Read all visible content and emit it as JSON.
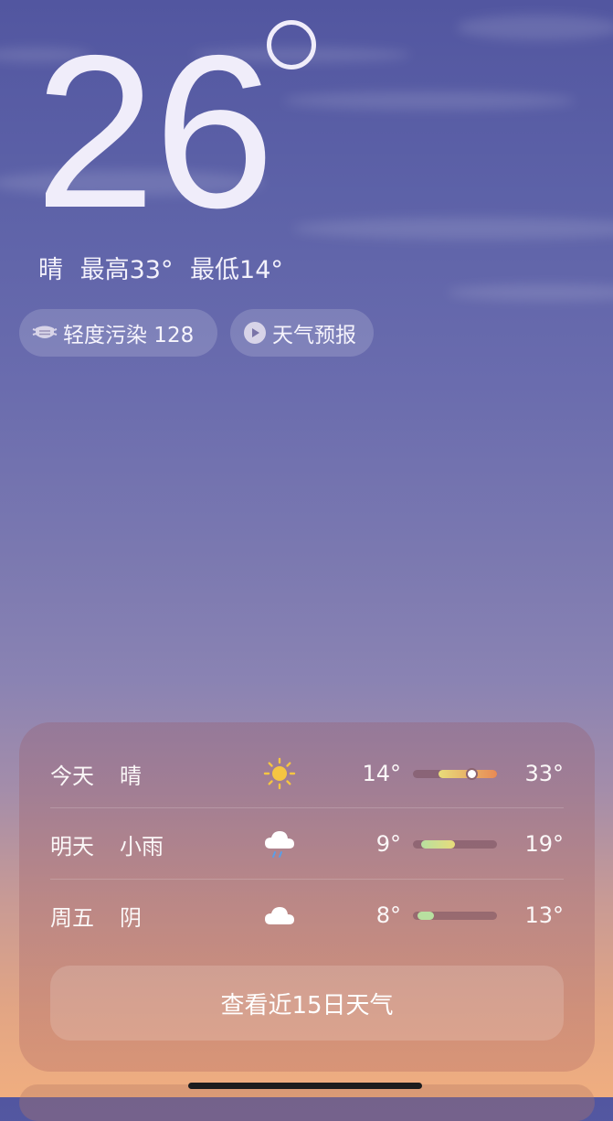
{
  "current": {
    "temperature": "26",
    "condition": "晴",
    "high_text": "最高33°",
    "low_text": "最低14°"
  },
  "chips": {
    "aqi_label": "轻度污染 128",
    "forecast_label": "天气预报"
  },
  "forecast": {
    "rows": [
      {
        "day": "今天",
        "condition": "晴",
        "icon": "sun-icon",
        "low": "14°",
        "high": "33°",
        "range_start": 0.3,
        "range_end": 1.0,
        "current_pos": 0.7
      },
      {
        "day": "明天",
        "condition": "小雨",
        "icon": "rain-cloud-icon",
        "low": "9°",
        "high": "19°",
        "range_start": 0.1,
        "range_end": 0.5
      },
      {
        "day": "周五",
        "condition": "阴",
        "icon": "cloud-icon",
        "low": "8°",
        "high": "13°",
        "range_start": 0.05,
        "range_end": 0.25
      }
    ],
    "cta_label": "查看近15日天气"
  },
  "colors": {
    "sky_top": "#5256a0",
    "sky_bottom": "#f0ae80",
    "sun": "#f5c542",
    "bar_warm": "#e8dc7a",
    "bar_hot": "#e88a55",
    "bar_cool": "#b8e0a0"
  }
}
